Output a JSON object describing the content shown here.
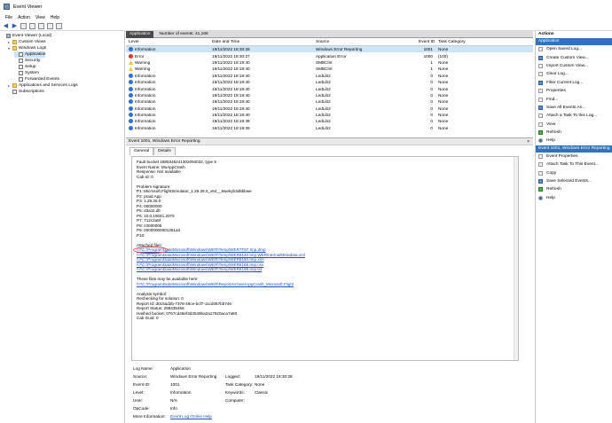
{
  "window": {
    "title": "Event Viewer"
  },
  "menu": [
    "File",
    "Action",
    "View",
    "Help"
  ],
  "tree": [
    {
      "label": "Event Viewer (Local)",
      "level": 0,
      "icon": "pc-icon",
      "expand": ""
    },
    {
      "label": "Custom Views",
      "level": 1,
      "icon": "folder-icon",
      "expand": "▸"
    },
    {
      "label": "Windows Logs",
      "level": 1,
      "icon": "folder-icon",
      "expand": "▾"
    },
    {
      "label": "Application",
      "level": 2,
      "icon": "log-icon",
      "expand": "",
      "selected": true
    },
    {
      "label": "Security",
      "level": 2,
      "icon": "log-icon",
      "expand": ""
    },
    {
      "label": "Setup",
      "level": 2,
      "icon": "log-icon",
      "expand": ""
    },
    {
      "label": "System",
      "level": 2,
      "icon": "log-icon",
      "expand": ""
    },
    {
      "label": "Forwarded Events",
      "level": 2,
      "icon": "log-icon",
      "expand": ""
    },
    {
      "label": "Applications and Services Logs",
      "level": 1,
      "icon": "folder-icon",
      "expand": "▸"
    },
    {
      "label": "Subscriptions",
      "level": 1,
      "icon": "log-icon",
      "expand": ""
    }
  ],
  "center": {
    "log_name": "Application",
    "count": "Number of events: 41,166"
  },
  "columns": [
    "Level",
    "Date and Time",
    "Source",
    "Event ID",
    "Task Category"
  ],
  "rows": [
    {
      "level": "Information",
      "kind": "info",
      "date": "19/11/2022 18:30:28",
      "source": "Windows Error Reporting",
      "id": "1001",
      "cat": "None",
      "selected": true
    },
    {
      "level": "Error",
      "kind": "err",
      "date": "19/11/2022 18:30:27",
      "source": "Application Error",
      "id": "1000",
      "cat": "(100)"
    },
    {
      "level": "Warning",
      "kind": "warn",
      "date": "19/11/2022 18:19:40",
      "source": "SMBClnt",
      "id": "1",
      "cat": "None"
    },
    {
      "level": "Warning",
      "kind": "warn",
      "date": "19/11/2022 18:19:40",
      "source": "SMBClnt",
      "id": "1",
      "cat": "None"
    },
    {
      "level": "Information",
      "kind": "info",
      "date": "19/11/2022 18:19:40",
      "source": "LedLib2",
      "id": "0",
      "cat": "None"
    },
    {
      "level": "Information",
      "kind": "info",
      "date": "19/11/2022 18:19:40",
      "source": "LedLib2",
      "id": "0",
      "cat": "None"
    },
    {
      "level": "Information",
      "kind": "info",
      "date": "19/11/2022 18:19:40",
      "source": "LedLib2",
      "id": "0",
      "cat": "None"
    },
    {
      "level": "Information",
      "kind": "info",
      "date": "19/11/2022 18:19:40",
      "source": "LedLib2",
      "id": "0",
      "cat": "None"
    },
    {
      "level": "Information",
      "kind": "info",
      "date": "19/11/2022 18:19:40",
      "source": "LedLib2",
      "id": "0",
      "cat": "None"
    },
    {
      "level": "Information",
      "kind": "info",
      "date": "19/11/2022 18:19:40",
      "source": "LedLib2",
      "id": "0",
      "cat": "None"
    },
    {
      "level": "Information",
      "kind": "info",
      "date": "19/11/2022 18:19:40",
      "source": "LedLib2",
      "id": "0",
      "cat": "None"
    },
    {
      "level": "Information",
      "kind": "info",
      "date": "19/11/2022 18:19:39",
      "source": "LedLib2",
      "id": "0",
      "cat": "None"
    },
    {
      "level": "Information",
      "kind": "info",
      "date": "19/11/2022 18:19:39",
      "source": "LedLib2",
      "id": "0",
      "cat": "None"
    }
  ],
  "detail": {
    "title": "Event 1001, Windows Error Reporting",
    "close": "×",
    "tabs": [
      "General",
      "Details"
    ],
    "lines": [
      {
        "t": "Fault bucket 1885345241302094032, type 5"
      },
      {
        "t": "Event Name: MoAppCrash"
      },
      {
        "t": "Response: Not available"
      },
      {
        "t": "Cab Id: 0"
      },
      {
        "t": ""
      },
      {
        "t": "Problem signature:"
      },
      {
        "t": "P1: Microsoft.FlightSimulator_1.29.28.0_x64__8wekyb3d8bbwe"
      },
      {
        "t": "P2: praid:App"
      },
      {
        "t": "P3: 1.29.28.0"
      },
      {
        "t": "P4: 00000000"
      },
      {
        "t": "P5: d3a11.dll"
      },
      {
        "t": "P6: 10.0.19041.2075"
      },
      {
        "t": "P7: 712c2a5f"
      },
      {
        "t": "P8: c0000005"
      },
      {
        "t": "P9: 00000000001351a3"
      },
      {
        "t": "P10:"
      },
      {
        "t": ""
      },
      {
        "t": "Attached files:"
      },
      {
        "t": "\\\\?\\C:\\ProgramData\\Microsoft\\Windows\\WER\\Temp\\WER7F87.tmp.dmp",
        "link": true
      },
      {
        "t": "\\\\?\\C:\\ProgramData\\Microsoft\\Windows\\WER\\Temp\\WER8140.tmp.WERInternalMetadata.xml",
        "link": true
      },
      {
        "t": "\\\\?\\C:\\ProgramData\\Microsoft\\Windows\\WER\\Temp\\WER8160.tmp.xml",
        "link": true
      },
      {
        "t": "\\\\?\\C:\\ProgramData\\Microsoft\\Windows\\WER\\Temp\\WER8168.tmp.csv",
        "link": true
      },
      {
        "t": "\\\\?\\C:\\ProgramData\\Microsoft\\Windows\\WER\\Temp\\WER8198.tmp.txt",
        "link": true
      },
      {
        "t": ""
      },
      {
        "t": "These files may be available here:"
      },
      {
        "t": "\\\\?\\C:\\ProgramData\\Microsoft\\Windows\\WER\\ReportArchive\\AppCrash_Microsoft.Flight",
        "link": true
      },
      {
        "t": ""
      },
      {
        "t": "Analysis symbol:"
      },
      {
        "t": "Rechecking for solution: 0"
      },
      {
        "t": "Report Id: d015ad2b-7378-46ce-bcf7-11cd067bb746"
      },
      {
        "t": "Report Status: 268435456"
      },
      {
        "t": "Hashed bucket: 0767cd48ef3d2549ba2a17820aca7a80"
      },
      {
        "t": "Cab Guid: 0"
      }
    ],
    "props": {
      "log_name_k": "Log Name:",
      "log_name_v": "Application",
      "source_k": "Source:",
      "source_v": "Windows Error Reporting",
      "logged_k": "Logged:",
      "logged_v": "19/11/2022 18:30:28",
      "event_id_k": "Event ID:",
      "event_id_v": "1001",
      "task_k": "Task Category:",
      "task_v": "None",
      "level_k": "Level:",
      "level_v": "Information",
      "keywords_k": "Keywords:",
      "keywords_v": "Classic",
      "user_k": "User:",
      "user_v": "N/A",
      "computer_k": "Computer:",
      "computer_v": "",
      "opcode_k": "OpCode:",
      "opcode_v": "Info",
      "more_k": "More Information:",
      "more_v": "Event Log Online Help"
    }
  },
  "actions": {
    "header": "Actions",
    "sec1": "Application",
    "items1": [
      {
        "label": "Open Saved Log...",
        "icon": "open-log-icon",
        "c": ""
      },
      {
        "label": "Create Custom View...",
        "icon": "filter-icon",
        "c": "blue"
      },
      {
        "label": "Import Custom View...",
        "icon": "import-icon",
        "c": ""
      },
      {
        "label": "Clear Log...",
        "icon": "clear-icon",
        "c": ""
      },
      {
        "label": "Filter Current Log...",
        "icon": "filter-icon",
        "c": "blue"
      },
      {
        "label": "Properties",
        "icon": "properties-icon",
        "c": ""
      },
      {
        "label": "Find...",
        "icon": "find-icon",
        "c": ""
      },
      {
        "label": "Save All Events As...",
        "icon": "save-icon",
        "c": "blue"
      },
      {
        "label": "Attach a Task To this Log...",
        "icon": "task-icon",
        "c": ""
      },
      {
        "label": "View",
        "icon": "view-icon",
        "c": ""
      },
      {
        "label": "Refresh",
        "icon": "refresh-icon",
        "c": "green"
      },
      {
        "label": "Help",
        "icon": "help-icon",
        "c": "help"
      }
    ],
    "sec2": "Event 1001, Windows Error Reporting",
    "items2": [
      {
        "label": "Event Properties",
        "icon": "properties-icon",
        "c": ""
      },
      {
        "label": "Attach Task To This Event...",
        "icon": "task-icon",
        "c": ""
      },
      {
        "label": "Copy",
        "icon": "copy-icon",
        "c": ""
      },
      {
        "label": "Save Selected Events...",
        "icon": "save-icon",
        "c": "blue"
      },
      {
        "label": "Refresh",
        "icon": "refresh-icon",
        "c": "green"
      },
      {
        "label": "Help",
        "icon": "help-icon",
        "c": "help"
      }
    ]
  }
}
